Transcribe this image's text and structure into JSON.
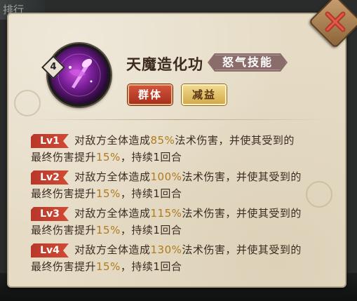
{
  "background": {
    "top_label": "排行"
  },
  "skill": {
    "level": "4",
    "name": "天魔造化功",
    "type": "怒气技能",
    "tags": [
      "群体",
      "减益"
    ]
  },
  "levels": [
    {
      "label": "Lv1",
      "l1a": "对敌方全体造成",
      "pct": "85%",
      "l1b": "法术伤害，并使其受到的",
      "l2a": "最终伤害提升",
      "pct2": "15%",
      "l2b": "，持续1回合"
    },
    {
      "label": "Lv2",
      "l1a": "对敌方全体造成",
      "pct": "100%",
      "l1b": "法术伤害，并使其受到的",
      "l2a": "最终伤害提升",
      "pct2": "15%",
      "l2b": "，持续1回合"
    },
    {
      "label": "Lv3",
      "l1a": "对敌方全体造成",
      "pct": "115%",
      "l1b": "法术伤害，并使其受到的",
      "l2a": "最终伤害提升",
      "pct2": "15%",
      "l2b": "，持续1回合"
    },
    {
      "label": "Lv4",
      "l1a": "对敌方全体造成",
      "pct": "130%",
      "l1b": "法术伤害，并使其受到的",
      "l2a": "最终伤害提升",
      "pct2": "15%",
      "l2b": "，持续1回合"
    }
  ],
  "colors": {
    "panel": "#e6dcc6",
    "accent_red": "#b8372a",
    "highlight": "#b07a1e"
  },
  "icons": {
    "close": "close-icon",
    "skill": "skill-icon"
  }
}
